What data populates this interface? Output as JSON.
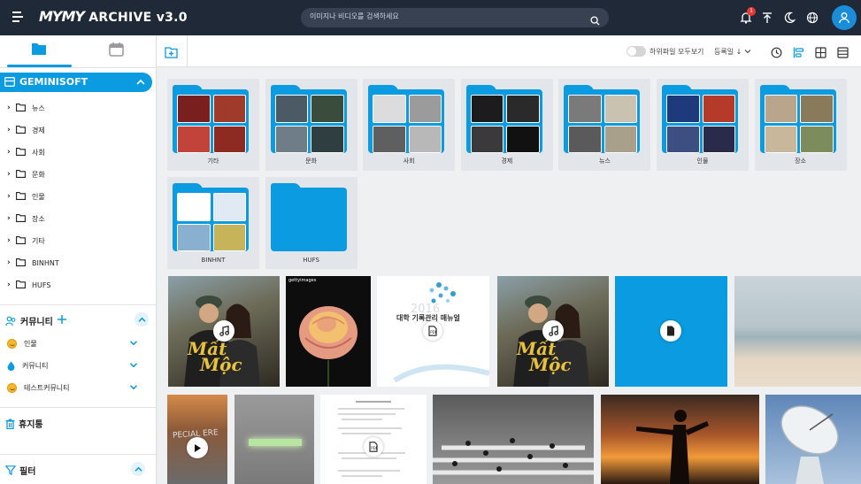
{
  "app": {
    "logo_brand": "MYMY",
    "logo_rest": "ARCHIVE",
    "version": "v3.0"
  },
  "search": {
    "placeholder": "이미지나 비디오를 검색하세요"
  },
  "notifications": {
    "count": "1"
  },
  "sidebar": {
    "group": "GEMINISOFT",
    "folders": [
      "뉴스",
      "경제",
      "사회",
      "문화",
      "인물",
      "장소",
      "기타",
      "BINHNT",
      "HUFS"
    ],
    "community_title": "커뮤니티",
    "communities": [
      {
        "label": "인물",
        "icon": "smile-emoji-icon"
      },
      {
        "label": "커뮤니티",
        "icon": "water-drop-icon"
      },
      {
        "label": "테스트커뮤니티",
        "icon": "smile-emoji-icon"
      }
    ],
    "trash": "휴지통",
    "filter": "필터"
  },
  "toolbar": {
    "show_subfiles_label": "하위파일 모두보기",
    "sort_label": "등록일",
    "show_subfiles_on": false
  },
  "folders": [
    {
      "label": "기타"
    },
    {
      "label": "문화"
    },
    {
      "label": "사회"
    },
    {
      "label": "경제"
    },
    {
      "label": "뉴스"
    },
    {
      "label": "인물"
    },
    {
      "label": "장소"
    },
    {
      "label": "BINHNT"
    },
    {
      "label": "HUFS"
    }
  ],
  "media": {
    "poster_title_line1": "Mất",
    "poster_title_line2": "Mộc",
    "document_title": "대학 기록관리 매뉴얼",
    "document_year": "2016",
    "getty_label": "gettyimages",
    "video_label": "PECIAL ERE"
  },
  "colors": {
    "accent": "#0a9be0",
    "topbar": "#1f2937",
    "badge": "#e53935"
  }
}
